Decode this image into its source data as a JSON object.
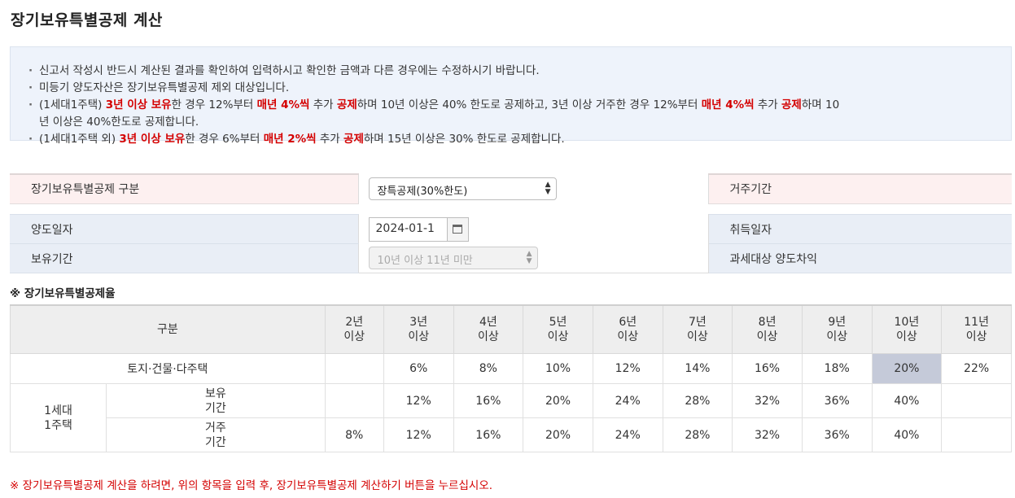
{
  "page_title": "장기보유특별공제 계산",
  "notice": [
    [
      {
        "t": "신고서 작성시 반드시 계산된 결과를 확인하여 입력하시고 확인한 금액과 다른 경우에는 수정하시기 바랍니다."
      }
    ],
    [
      {
        "t": "미등기 양도자산은 장기보유특별공제 제외 대상입니다."
      }
    ],
    [
      {
        "t": "(1세대1주택) "
      },
      {
        "t": "3년 이상 보유",
        "h": true
      },
      {
        "t": "한 경우 12%부터 "
      },
      {
        "t": "매년 4%씩",
        "h": true
      },
      {
        "t": " 추가 "
      },
      {
        "t": "공제",
        "h": true
      },
      {
        "t": "하며 10년 이상은 40% 한도로 공제하고, 3년 이상 거주한 경우 12%부터 "
      },
      {
        "t": "매년 4%씩",
        "h": true
      },
      {
        "t": " 추가 "
      },
      {
        "t": "공제",
        "h": true
      },
      {
        "t": "하며 10년 이상은 40%한도로 공제합니다."
      }
    ],
    [
      {
        "t": "(1세대1주택 외) "
      },
      {
        "t": "3년 이상 보유",
        "h": true
      },
      {
        "t": "한 경우 6%부터 "
      },
      {
        "t": "매년 2%씩",
        "h": true
      },
      {
        "t": " 추가 "
      },
      {
        "t": "공제",
        "h": true
      },
      {
        "t": "하며 15년 이상은 30% 한도로 공제합니다."
      }
    ]
  ],
  "form": {
    "category_label": "장기보유특별공제 구분",
    "category_value": "장특공제(30%한도)",
    "residence_label": "거주기간",
    "transfer_date_label": "양도일자",
    "transfer_date_value": "2024-01-1",
    "acquisition_date_label": "취득일자",
    "holding_label": "보유기간",
    "holding_value": "10년 이상 11년 미만",
    "gain_label": "과세대상 양도차익"
  },
  "rates_title": "※ 장기보유특별공제율",
  "rates": {
    "header_first": "구분",
    "columns": [
      {
        "a": "2년",
        "b": "이상"
      },
      {
        "a": "3년",
        "b": "이상"
      },
      {
        "a": "4년",
        "b": "이상"
      },
      {
        "a": "5년",
        "b": "이상"
      },
      {
        "a": "6년",
        "b": "이상"
      },
      {
        "a": "7년",
        "b": "이상"
      },
      {
        "a": "8년",
        "b": "이상"
      },
      {
        "a": "9년",
        "b": "이상"
      },
      {
        "a": "10년",
        "b": "이상"
      },
      {
        "a": "11년",
        "b": "이상"
      }
    ],
    "row_land": {
      "label": "토지·건물·다주택",
      "values": [
        "",
        "6%",
        "8%",
        "10%",
        "12%",
        "14%",
        "16%",
        "18%",
        "20%",
        "22%"
      ],
      "highlight_index": 8
    },
    "group_label": {
      "a": "1세대",
      "b": "1주택"
    },
    "row_hold": {
      "label_a": "보유",
      "label_b": "기간",
      "values": [
        "",
        "12%",
        "16%",
        "20%",
        "24%",
        "28%",
        "32%",
        "36%",
        "40%",
        ""
      ]
    },
    "row_live": {
      "label_a": "거주",
      "label_b": "기간",
      "values": [
        "8%",
        "12%",
        "16%",
        "20%",
        "24%",
        "28%",
        "32%",
        "36%",
        "40%",
        ""
      ]
    }
  },
  "bottom_note": "※ 장기보유특별공제 계산을 하려면, 위의 항목을 입력 후, 장기보유특별공제 계산하기 버튼을 누르십시오."
}
